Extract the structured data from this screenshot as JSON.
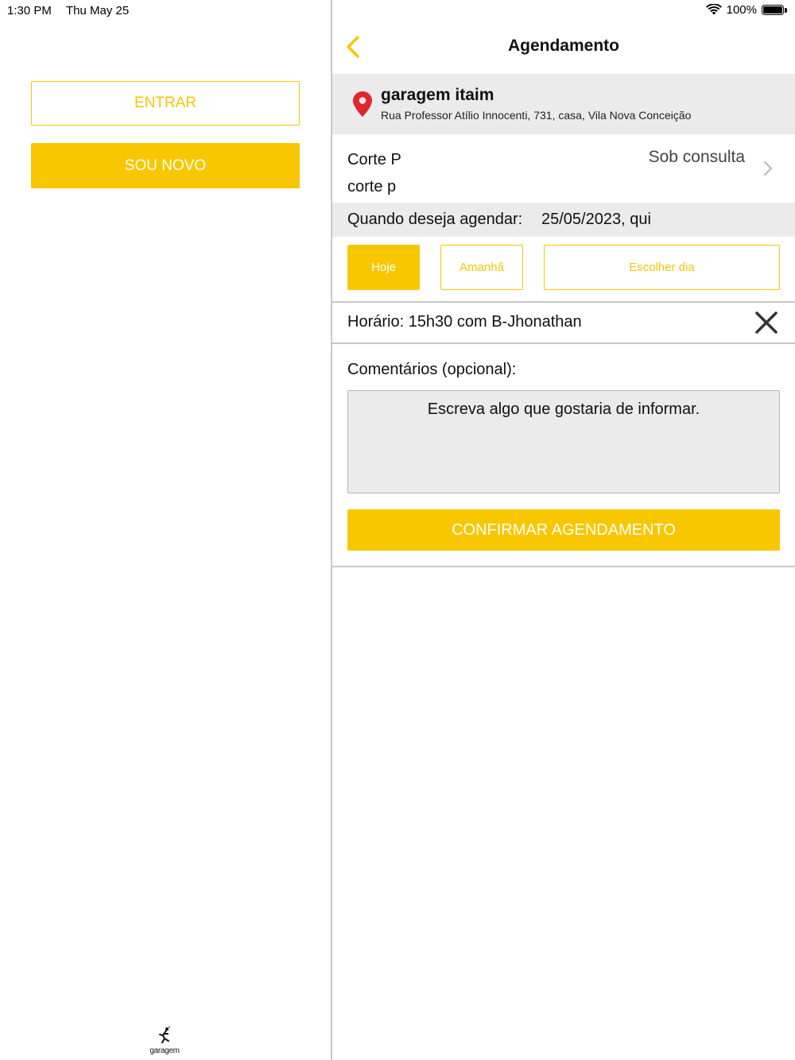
{
  "status_bar": {
    "time": "1:30 PM",
    "date": "Thu May 25",
    "battery": "100%"
  },
  "left_panel": {
    "login_label": "ENTRAR",
    "signup_label": "SOU NOVO",
    "logo_text": "garagem"
  },
  "header": {
    "title": "Agendamento"
  },
  "location": {
    "name": "garagem itaim",
    "address": "Rua Professor Atílio Innocenti, 731, casa, Vila Nova Conceição"
  },
  "service": {
    "name": "Corte P",
    "description": "corte p",
    "price": "Sob consulta"
  },
  "date": {
    "label": "Quando deseja agendar:",
    "value": "25/05/2023, qui"
  },
  "date_options": {
    "today": "Hoje",
    "tomorrow": "Amanhã",
    "choose": "Escolher dia",
    "selected": "Hoje"
  },
  "time_slot": {
    "text": "Horário: 15h30 com B-Jhonathan"
  },
  "comments": {
    "label": "Comentários (opcional):",
    "placeholder": "Escreva algo que gostaria de informar.",
    "value": ""
  },
  "confirm_label": "CONFIRMAR AGENDAMENTO",
  "colors": {
    "accent": "#f8c700",
    "pin": "#e0262c",
    "panel_gray": "#ebebeb"
  }
}
